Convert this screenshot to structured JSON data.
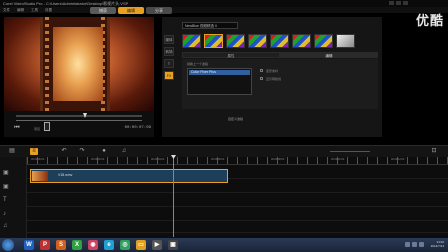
{
  "window": {
    "title": "Corel VideoStudio Pro - C:\\Users\\Administrator\\Desktop\\影视片头.VSP",
    "watermark": "优酷"
  },
  "menu": {
    "items": [
      "文件",
      "编辑",
      "工具",
      "设置"
    ]
  },
  "steps": {
    "capture": "捕获",
    "edit": "编辑",
    "share": "分享"
  },
  "preview": {
    "project_label": "项目",
    "timecode": "00:00:07:09"
  },
  "library": {
    "gallery": "NewBlue 视频精选 II",
    "tabs": [
      "媒体",
      "转场",
      "T",
      "FX"
    ],
    "option_tabs": {
      "attribute": "属性",
      "edit": "编辑"
    },
    "effect_label": "替换上一个滤镜",
    "effect_item": "Color Fixer Plus",
    "customize": "自定义滤镜",
    "checkbox_label": "变形素材",
    "checkbox2_label": "显示网格线"
  },
  "timeline": {
    "ruler": [
      "00:00:00:00",
      "00:00:02:00",
      "00:00:04:00",
      "00:00:06:00",
      "00:00:08:00",
      "00:00:10:00",
      "00:00:12:00"
    ],
    "clip_name": "V18.wmv"
  },
  "taskbar": {
    "time": "14:02",
    "date": "2014/7/14"
  },
  "colors": {
    "accent": "#e8a020",
    "clip": "#1e3f59",
    "playhead": "#5a8fd0"
  }
}
